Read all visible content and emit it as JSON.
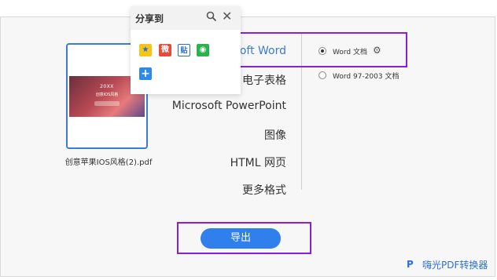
{
  "file": {
    "name": "创意苹果IOS风格(2).pdf",
    "thumb_title": "20XX",
    "thumb_subtitle": "创意IOS风格"
  },
  "formats": [
    {
      "label": "Microsoft Word",
      "visible_text": "oft Word",
      "active": true
    },
    {
      "label": "电子表格",
      "active": false
    },
    {
      "label": "Microsoft PowerPoint",
      "active": false
    },
    {
      "label": "图像",
      "active": false
    },
    {
      "label": "HTML 网页",
      "active": false
    },
    {
      "label": "更多格式",
      "active": false
    }
  ],
  "word_options": [
    {
      "label": "Word 文档",
      "checked": true
    },
    {
      "label": "Word 97-2003 文档",
      "checked": false
    }
  ],
  "share": {
    "title": "分享到",
    "icons": [
      "qzone-icon",
      "weibo-icon",
      "tieba-icon",
      "wechat-icon",
      "more-plus-icon"
    ]
  },
  "export_label": "导出",
  "brand": "嗨光PDF转换器",
  "colors": {
    "accent": "#2f80ed",
    "highlight": "#8a1fd6"
  }
}
